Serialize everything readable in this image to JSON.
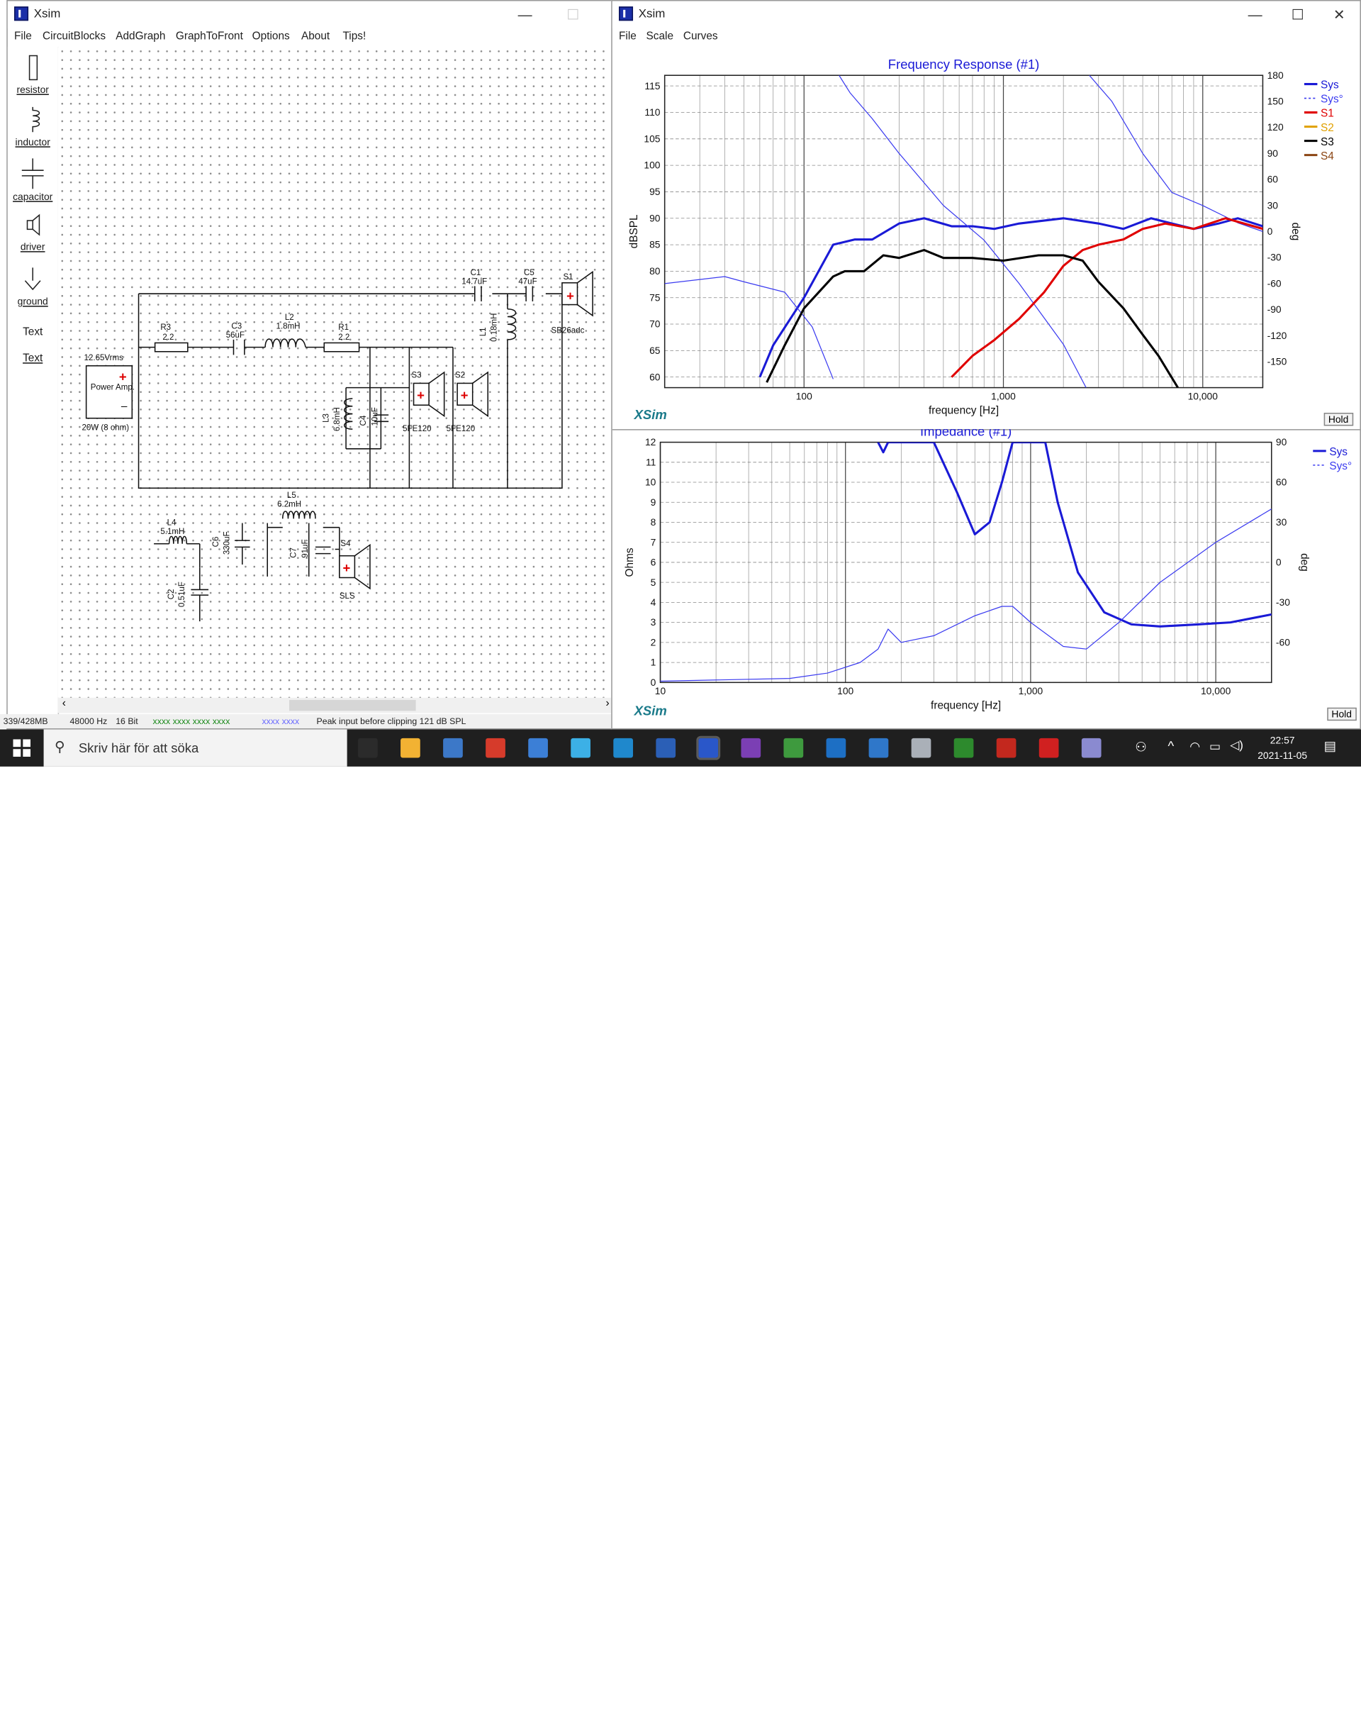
{
  "left_window": {
    "title": "Xsim",
    "menu": [
      "File",
      "CircuitBlocks",
      "AddGraph",
      "GraphToFront",
      "Options",
      "About",
      "Tips!"
    ],
    "palette": [
      {
        "label": "resistor",
        "icon": "resistor-icon"
      },
      {
        "label": "inductor",
        "icon": "inductor-icon"
      },
      {
        "label": "capacitor",
        "icon": "capacitor-icon"
      },
      {
        "label": "driver",
        "icon": "driver-icon"
      },
      {
        "label": "ground",
        "icon": "ground-icon"
      },
      {
        "label": "Text",
        "icon": "text-icon"
      },
      {
        "label": "Text",
        "icon": "text-link"
      }
    ],
    "schematic": {
      "source": {
        "voltage": "12.65Vrms",
        "name": "Power Amp.",
        "rating": "20W (8 ohm)"
      },
      "components": {
        "R3": {
          "name": "R3",
          "value": "2.2"
        },
        "C3": {
          "name": "C3",
          "value": "56uF"
        },
        "L2": {
          "name": "L2",
          "value": "1.8mH"
        },
        "R1": {
          "name": "R1",
          "value": "2.2"
        },
        "C1": {
          "name": "C1",
          "value": "14.7uF"
        },
        "C5": {
          "name": "C5",
          "value": "47uF"
        },
        "L1": {
          "name": "L1",
          "value": "0.18mH"
        },
        "L3": {
          "name": "L3",
          "value": "6.8mH"
        },
        "C4": {
          "name": "C4",
          "value": "10uF"
        },
        "L4": {
          "name": "L4",
          "value": "5.1mH"
        },
        "C6": {
          "name": "C6",
          "value": "330uF"
        },
        "C2": {
          "name": "C2",
          "value": "0.51uF"
        },
        "L5": {
          "name": "L5",
          "value": "6.2mH"
        },
        "C7": {
          "name": "C7",
          "value": "91uF"
        }
      },
      "drivers": {
        "S1": {
          "name": "S1",
          "model": "SB26adc"
        },
        "S2": {
          "name": "S2",
          "model": "5FE120"
        },
        "S3": {
          "name": "S3",
          "model": "5FE120"
        },
        "S4": {
          "name": "S4",
          "model": "SLS"
        }
      }
    },
    "status": {
      "memory": "339/428MB",
      "rate": "48000 Hz",
      "bits": "16 Bit",
      "meter": "xxxx xxxx  xxxx xxxx",
      "meter2": "xxxx xxxx",
      "message": "Peak input before clipping 121 dB SPL"
    }
  },
  "right_window": {
    "title": "Xsim",
    "menu": [
      "File",
      "Scale",
      "Curves"
    ],
    "brand": "XSim",
    "hold_label": "Hold"
  },
  "chart_data": [
    {
      "type": "line",
      "title": "Frequency Response (#1)",
      "xlabel": "frequency [Hz]",
      "ylabel": "dBSPL",
      "y2label": "deg",
      "x_scale": "log",
      "xlim": [
        20,
        20000
      ],
      "ylim": [
        58,
        117
      ],
      "y2lim": [
        -180,
        180
      ],
      "x_ticks": [
        "100",
        "1,000",
        "10,000"
      ],
      "y_ticks": [
        60,
        65,
        70,
        75,
        80,
        85,
        90,
        95,
        100,
        105,
        110,
        115
      ],
      "y2_ticks": [
        180,
        150,
        120,
        90,
        60,
        30,
        0,
        -30,
        -60,
        -90,
        -120,
        -150
      ],
      "grid": true,
      "legend": "right",
      "series": [
        {
          "name": "Sys",
          "color": "#1a1ad6",
          "axis": "left",
          "x": [
            60,
            70,
            100,
            140,
            180,
            220,
            300,
            400,
            550,
            700,
            900,
            1200,
            2000,
            3000,
            4000,
            5500,
            7000,
            9000,
            12000,
            15000,
            20000
          ],
          "values": [
            60,
            66,
            75,
            85,
            86,
            86,
            89,
            90,
            88.5,
            88.5,
            88,
            89,
            90,
            89,
            88,
            90,
            89,
            88,
            89,
            90,
            88.5
          ]
        },
        {
          "name": "Sys°",
          "color": "#3b3bf0",
          "dashed": true,
          "axis": "right",
          "x": [
            20,
            40,
            50,
            80,
            110,
            140,
            150,
            170,
            220,
            300,
            500,
            800,
            1200,
            2000,
            2600,
            2700,
            3500,
            5000,
            7000,
            10000,
            15000,
            20000
          ],
          "values": [
            -60,
            -52,
            -58,
            -70,
            -110,
            -170,
            180,
            160,
            130,
            90,
            30,
            -10,
            -60,
            -130,
            -180,
            180,
            150,
            90,
            45,
            30,
            10,
            0
          ]
        },
        {
          "name": "S1",
          "color": "#e00000",
          "axis": "left",
          "x": [
            550,
            700,
            900,
            1200,
            1600,
            2000,
            2500,
            3000,
            4000,
            5000,
            6500,
            9000,
            13000,
            20000
          ],
          "values": [
            60,
            64,
            67,
            71,
            76,
            81,
            84,
            85,
            86,
            88,
            89,
            88,
            90,
            88
          ]
        },
        {
          "name": "S2",
          "color": "#e0a000",
          "axis": "left",
          "x": [],
          "values": []
        },
        {
          "name": "S3",
          "color": "#000000",
          "axis": "left",
          "x": [
            65,
            80,
            100,
            140,
            160,
            200,
            250,
            300,
            400,
            500,
            700,
            1000,
            1500,
            2000,
            2500,
            3000,
            4000,
            5000,
            6000,
            7500
          ],
          "values": [
            59,
            66,
            73,
            79,
            80,
            80,
            83,
            82.5,
            84,
            82.5,
            82.5,
            82,
            83,
            83,
            82,
            78,
            73,
            68,
            64,
            58
          ]
        },
        {
          "name": "S4",
          "color": "#8b4513",
          "axis": "left",
          "x": [],
          "values": []
        }
      ]
    },
    {
      "type": "line",
      "title": "Impedance (#1)",
      "xlabel": "frequency [Hz]",
      "ylabel": "Ohms",
      "y2label": "deg",
      "x_scale": "log",
      "xlim": [
        10,
        20000
      ],
      "ylim": [
        0,
        12
      ],
      "y2lim": [
        -90,
        90
      ],
      "x_ticks": [
        "10",
        "100",
        "1,000",
        "10,000"
      ],
      "y_ticks": [
        0,
        1,
        2,
        3,
        4,
        5,
        6,
        7,
        8,
        9,
        10,
        11,
        12
      ],
      "y2_ticks": [
        90,
        60,
        30,
        0,
        -30,
        -60
      ],
      "grid": true,
      "legend": "right",
      "series": [
        {
          "name": "Sys",
          "color": "#1a1ad6",
          "axis": "left",
          "x": [
            150,
            160,
            170,
            300,
            400,
            500,
            600,
            700,
            800,
            1200,
            1400,
            1800,
            2500,
            3500,
            5000,
            8000,
            12000,
            20000
          ],
          "values": [
            12,
            11.5,
            12,
            12,
            9.5,
            7.4,
            8,
            10,
            12,
            12,
            9,
            5.5,
            3.5,
            2.9,
            2.8,
            2.9,
            3.0,
            3.4
          ]
        },
        {
          "name": "Sys°",
          "color": "#3b3bf0",
          "dashed": true,
          "axis": "right",
          "x": [
            10,
            50,
            80,
            120,
            150,
            170,
            200,
            300,
            500,
            700,
            800,
            1000,
            1500,
            2000,
            3000,
            5000,
            10000,
            20000
          ],
          "values": [
            -89,
            -87,
            -83,
            -75,
            -65,
            -50,
            -60,
            -55,
            -40,
            -33,
            -33,
            -45,
            -63,
            -65,
            -45,
            -15,
            15,
            40
          ]
        }
      ]
    }
  ],
  "taskbar": {
    "search_placeholder": "Skriv här för att söka",
    "time": "22:57",
    "date": "2021-11-05",
    "apps": [
      "task-view",
      "file-explorer",
      "store",
      "app-red",
      "mail",
      "edge",
      "app-l",
      "word",
      "xsim",
      "onenote",
      "chrome",
      "outlook",
      "photos",
      "scanner",
      "rew",
      "acrobat",
      "app-triangle",
      "paint"
    ]
  }
}
